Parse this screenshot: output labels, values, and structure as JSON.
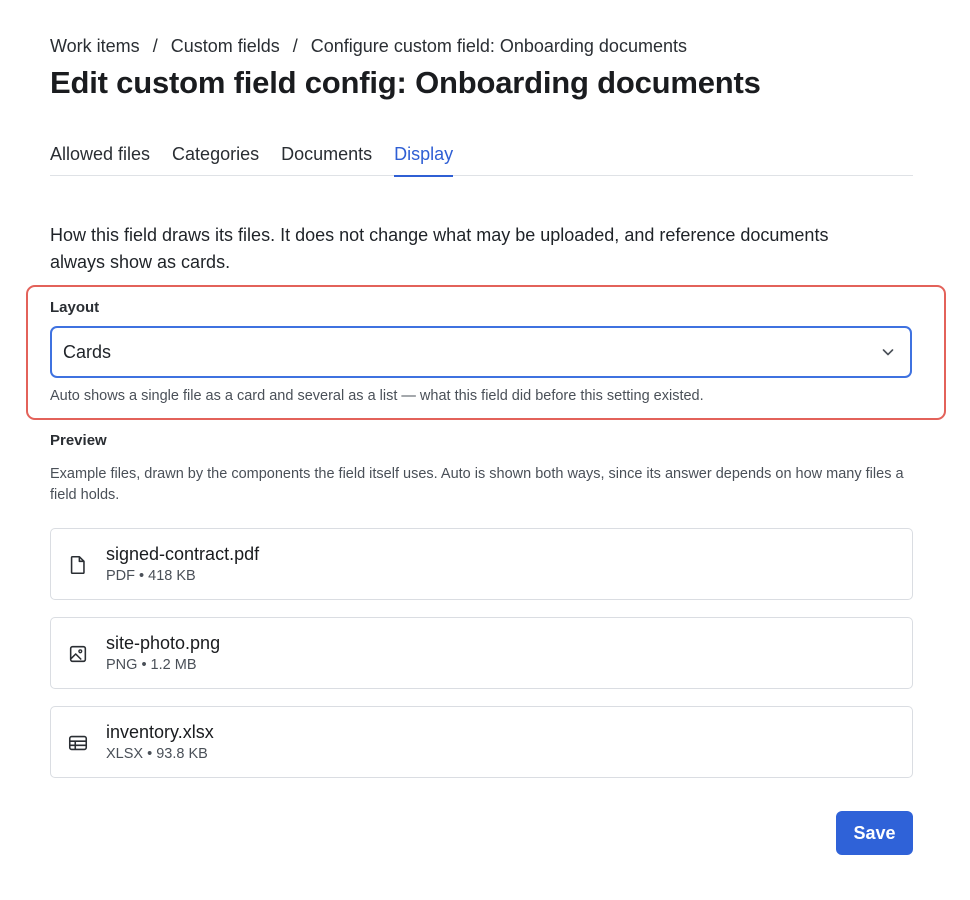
{
  "breadcrumb": [
    "Work items",
    "Custom fields",
    "Configure custom field: Onboarding documents"
  ],
  "breadcrumb_separator": "/",
  "title": "Edit custom field config: Onboarding documents",
  "tabs": [
    {
      "label": "Allowed files",
      "active": false
    },
    {
      "label": "Categories",
      "active": false
    },
    {
      "label": "Documents",
      "active": false
    },
    {
      "label": "Display",
      "active": true
    }
  ],
  "intro": "How this field draws its files. It does not change what may be uploaded, and reference documents always show as cards.",
  "layout": {
    "label": "Layout",
    "selected": "Cards",
    "help": "Auto shows a single file as a card and several as a list — what this field did before this setting existed."
  },
  "preview": {
    "label": "Preview",
    "description": "Example files, drawn by the components the field itself uses. Auto is shown both ways, since its answer depends on how many files a field holds."
  },
  "files": [
    {
      "name": "signed-contract.pdf",
      "meta": "PDF • 418 KB",
      "icon": "document-icon"
    },
    {
      "name": "site-photo.png",
      "meta": "PNG • 1.2 MB",
      "icon": "image-icon"
    },
    {
      "name": "inventory.xlsx",
      "meta": "XLSX • 93.8 KB",
      "icon": "spreadsheet-icon"
    }
  ],
  "save_label": "Save",
  "colors": {
    "accent": "#2f62d8",
    "highlight_border": "#e3625a"
  }
}
